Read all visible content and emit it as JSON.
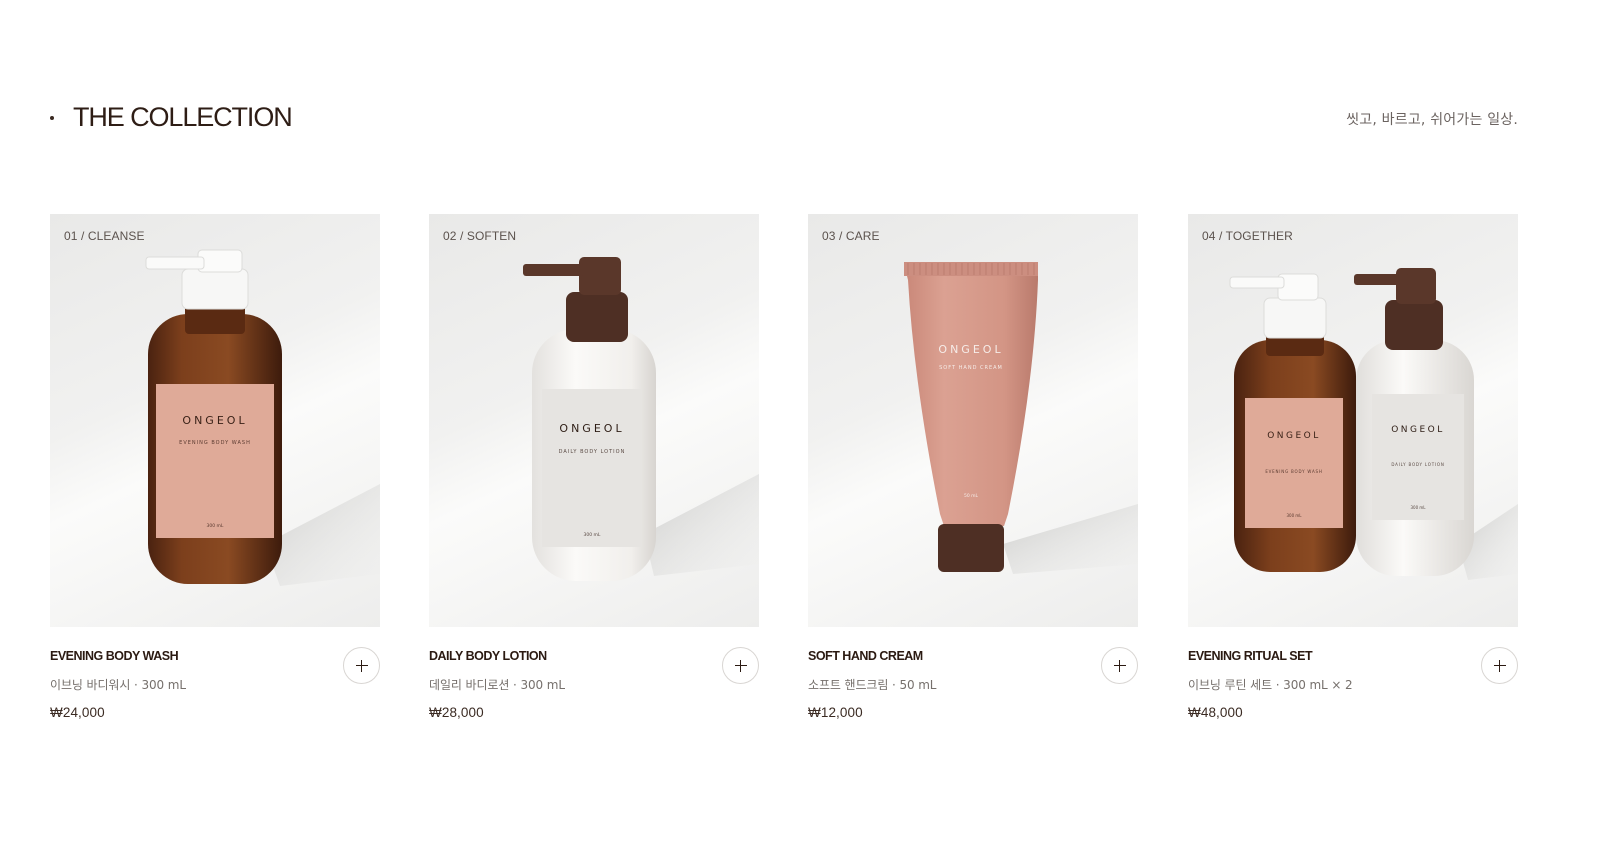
{
  "section": {
    "title": "THE COLLECTION",
    "tagline": "씻고, 바르고, 쉬어가는 일상."
  },
  "products": [
    {
      "tag": "01 / CLEANSE",
      "name": "EVENING BODY WASH",
      "subtitle": "이브닝 바디워시 · 300 mL",
      "price": "₩24,000",
      "label": {
        "brand": "ONGEOL",
        "product": "EVENING BODY WASH",
        "volume": "300 mL"
      },
      "add_icon": "plus-icon"
    },
    {
      "tag": "02 / SOFTEN",
      "name": "DAILY BODY LOTION",
      "subtitle": "데일리 바디로션 · 300 mL",
      "price": "₩28,000",
      "label": {
        "brand": "ONGEOL",
        "product": "DAILY BODY LOTION",
        "volume": "300 mL"
      },
      "add_icon": "plus-icon"
    },
    {
      "tag": "03 / CARE",
      "name": "SOFT HAND CREAM",
      "subtitle": "소프트 핸드크림 · 50 mL",
      "price": "₩12,000",
      "label": {
        "brand": "ONGEOL",
        "product": "SOFT HAND CREAM",
        "volume": "50 mL"
      },
      "add_icon": "plus-icon"
    },
    {
      "tag": "04 / TOGETHER",
      "name": "EVENING RITUAL SET",
      "subtitle": "이브닝 루틴 세트 · 300 mL × 2",
      "price": "₩48,000",
      "label_left": {
        "brand": "ONGEOL",
        "product": "EVENING BODY WASH",
        "volume": "300 mL"
      },
      "label_right": {
        "brand": "ONGEOL",
        "product": "DAILY BODY LOTION",
        "volume": "300 mL"
      },
      "add_icon": "plus-icon"
    }
  ],
  "colors": {
    "text_primary": "#2b1a12",
    "text_muted": "#76706c",
    "amber_bottle": "#7a3e1c",
    "label_pink": "#dfaa98",
    "cream_bottle": "#f4f2ef",
    "brown_pump": "#4e2f24",
    "tube_pink": "#d7988a"
  }
}
